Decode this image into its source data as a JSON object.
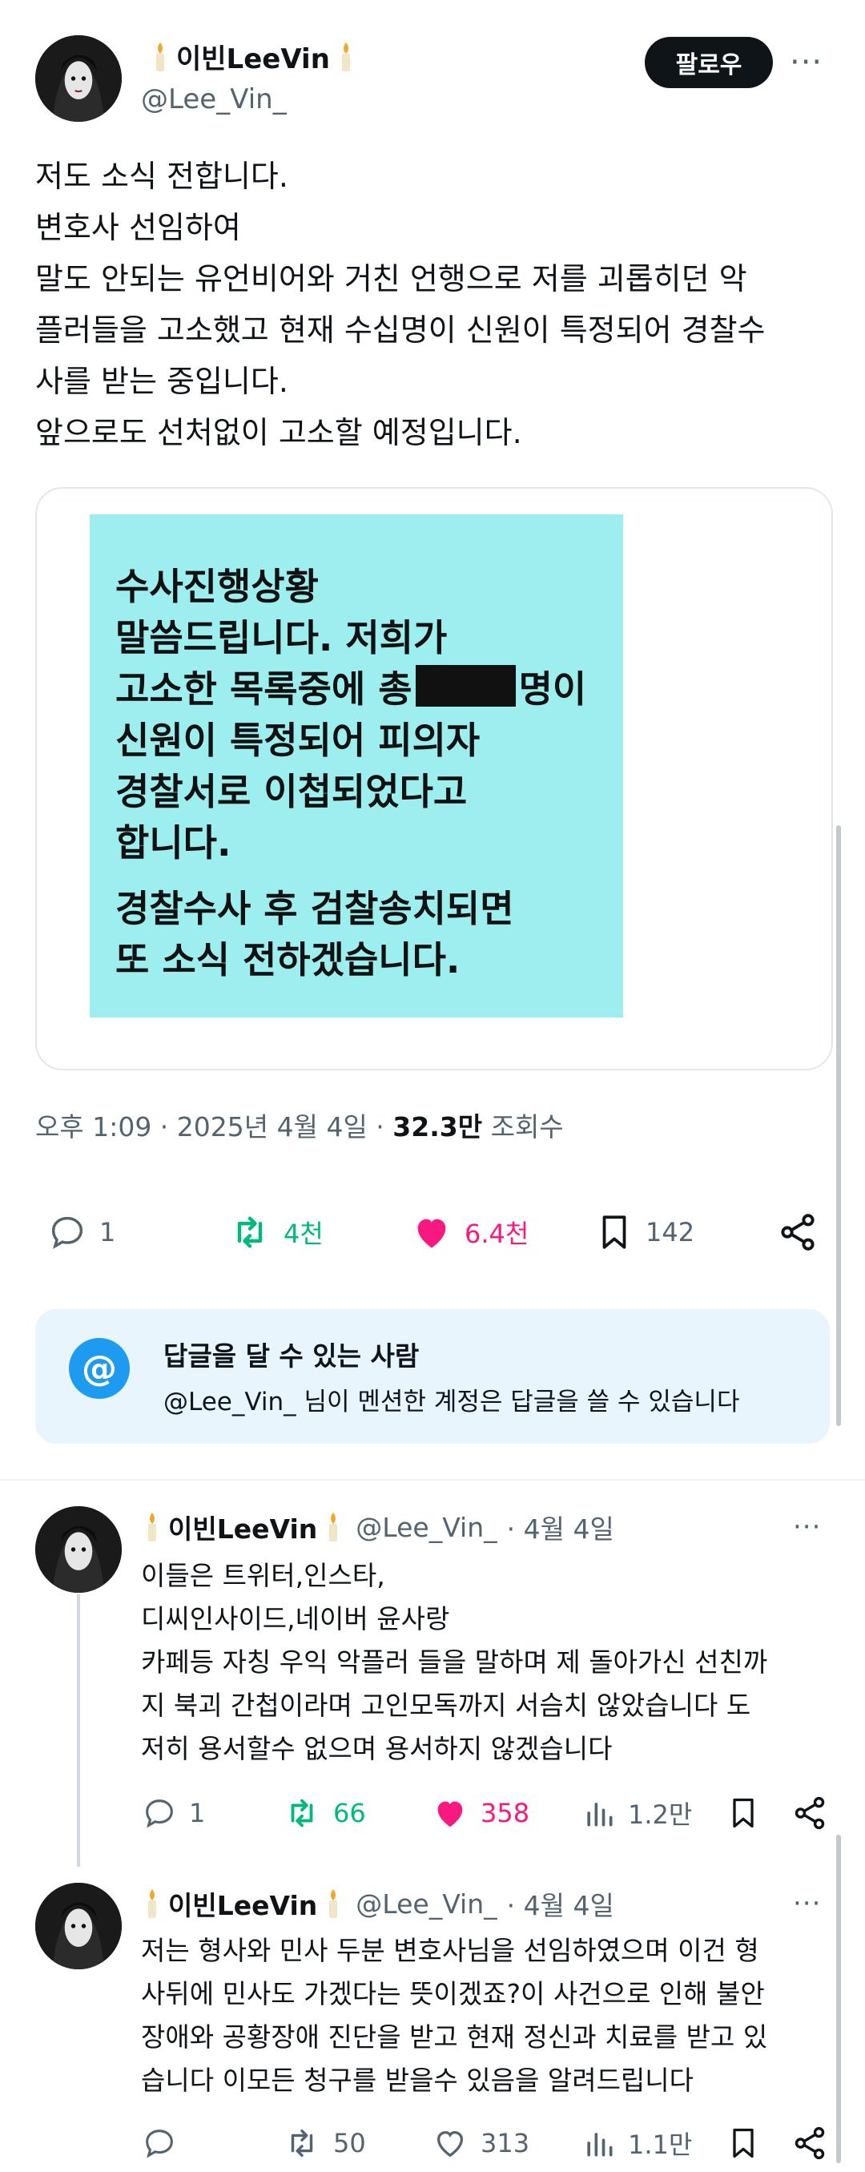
{
  "main_tweet": {
    "author_name": "이빈LeeVin",
    "author_handle": "@Lee_Vin_",
    "follow_label": "팔로우",
    "more_label": "···",
    "text_lines": [
      "저도 소식 전합니다.",
      "변호사 선임하여",
      "말도 안되는 유언비어와 거친 언행으로 저를 괴롭히던 악",
      "플러들을 고소했고 현재 수십명이 신원이 특정되어 경찰수",
      "사를 받는 중입니다.",
      "앞으로도 선처없이 고소할 예정입니다."
    ],
    "image_text": {
      "line1": "수사진행상황",
      "line2": "말씀드립니다. 저희가",
      "line3_before": "고소한 목록중에 총",
      "line3_after": "명이",
      "line4": "신원이 특정되어 피의자",
      "line5": "경찰서로  이첩되었다고",
      "line6": "합니다.",
      "line7": "경찰수사 후 검찰송치되면",
      "line8": "또 소식 전하겠습니다."
    },
    "timestamp": "오후 1:09 · 2025년 4월 4일 ·",
    "views_count": "32.3만",
    "views_label": "조회수",
    "replies": "1",
    "retweets": "4천",
    "likes": "6.4천",
    "bookmarks": "142"
  },
  "reply_restriction": {
    "title": "답글을 달 수 있는 사람",
    "subtitle": "@Lee_Vin_ 님이 멘션한 계정은 답글을 쓸 수 있습니다",
    "icon_label": "@"
  },
  "thread": [
    {
      "author_name": "이빈LeeVin",
      "author_handle": "@Lee_Vin_",
      "date": "· 4월 4일",
      "more_label": "···",
      "text_lines": [
        "이들은 트위터,인스타,",
        "디씨인사이드,네이버 윤사랑",
        "카페등 자칭 우익 악플러 들을 말하며 제 돌아가신 선친까",
        "지 북괴 간첩이라며 고인모독까지 서슴치 않았습니다 도",
        "저히 용서할수 없으며 용서하지 않겠습니다"
      ],
      "replies": "1",
      "retweets": "66",
      "likes": "358",
      "views": "1.2만"
    },
    {
      "author_name": "이빈LeeVin",
      "author_handle": "@Lee_Vin_",
      "date": "· 4월 4일",
      "more_label": "···",
      "text_lines": [
        "저는 형사와 민사 두분 변호사님을 선임하였으며 이건 형",
        "사뒤에 민사도 가겠다는 뜻이겠죠?이 사건으로 인해 불안",
        "장애와 공황장애 진단을 받고 현재 정신과 치료를 받고 있",
        "습니다 이모든 청구를 받을수 있음을 알려드립니다"
      ],
      "replies": "",
      "retweets": "50",
      "likes": "313",
      "views": "1.1만"
    }
  ],
  "colors": {
    "text": "#0f1419",
    "secondary": "#536471",
    "retweet_green": "#00ba7c",
    "like_pink": "#f91880",
    "accent_blue": "#1d9bf0",
    "note_background": "#9defef"
  }
}
